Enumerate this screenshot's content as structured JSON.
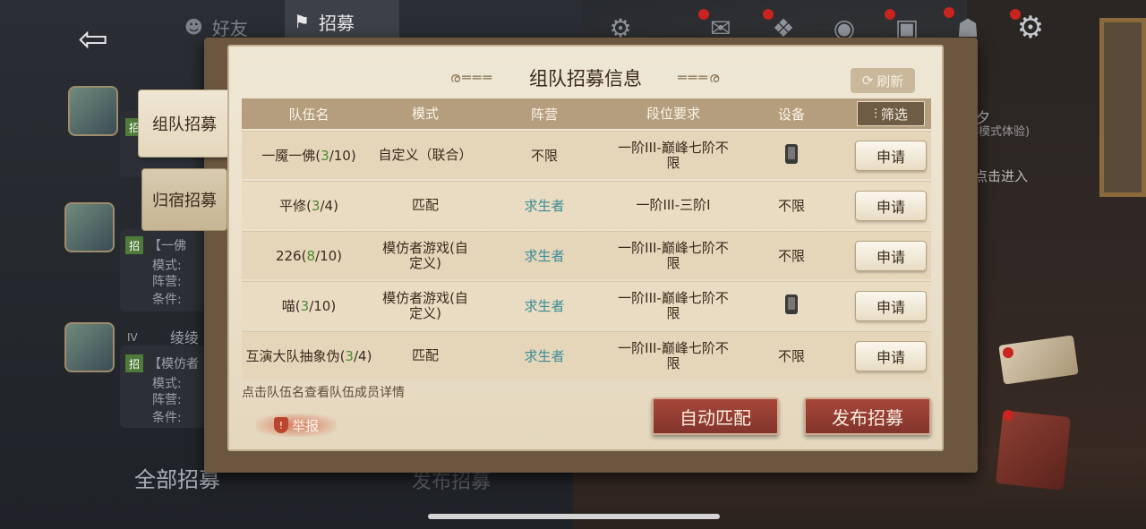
{
  "top_bar": {
    "friends_tab": "好友",
    "recruit_tab": "招募"
  },
  "side_tabs": {
    "group": "组队招募",
    "dorm": "归宿招募"
  },
  "panel": {
    "title": "组队招募信息",
    "refresh_label": "刷新",
    "filter_label": "筛选",
    "columns": [
      "队伍名",
      "模式",
      "阵营",
      "段位要求",
      "设备"
    ],
    "rows": [
      {
        "name": "一魇一佛",
        "count": "3",
        "total": "/10",
        "mode": "自定义（联合）",
        "camp": "不限",
        "camp_survivor": false,
        "rank": "一阶III-巅峰七阶不限",
        "device": "phone",
        "device_text": "",
        "action": "申请"
      },
      {
        "name": "平修",
        "count": "3",
        "total": "/4",
        "mode": "匹配",
        "camp": "求生者",
        "camp_survivor": true,
        "rank": "一阶III-三阶I",
        "device": "none",
        "device_text": "不限",
        "action": "申请"
      },
      {
        "name": "226",
        "count": "8",
        "total": "/10",
        "mode": "模仿者游戏(自定义)",
        "camp": "求生者",
        "camp_survivor": true,
        "rank": "一阶III-巅峰七阶不限",
        "device": "none",
        "device_text": "不限",
        "action": "申请"
      },
      {
        "name": "喵",
        "count": "3",
        "total": "/10",
        "mode": "模仿者游戏(自定义)",
        "camp": "求生者",
        "camp_survivor": true,
        "rank": "一阶III-巅峰七阶不限",
        "device": "phone",
        "device_text": "",
        "action": "申请"
      },
      {
        "name": "互演大队抽象伪",
        "count": "3",
        "total": "/4",
        "mode": "匹配",
        "camp": "求生者",
        "camp_survivor": true,
        "rank": "一阶III-巅峰七阶不限",
        "device": "none",
        "device_text": "不限",
        "action": "申请"
      }
    ],
    "hint": "点击队伍名查看队伍成员详情",
    "report_label": "举报",
    "auto_match_label": "自动匹配",
    "publish_label": "发布招募"
  },
  "background": {
    "all_recruit": "全部招募",
    "publish": "发布招募",
    "right_line1": "夕",
    "right_line2": "情模式体验)",
    "right_line3": "点击进入",
    "card1_badge": "招",
    "card2_badge": "招",
    "card2_title": "【一佛",
    "card2_lines": [
      "模式:",
      "阵营:",
      "条件:"
    ],
    "card3_badge": "招",
    "card3_title": "【模仿者",
    "card3_lines": [
      "模式:",
      "阵营:",
      "条件:"
    ],
    "card3_name": "绫绫",
    "card3_level": "IV"
  },
  "colors": {
    "survivor": "#3a8c97",
    "count_green": "#4a8a2f",
    "red_button": "#a7473a"
  }
}
